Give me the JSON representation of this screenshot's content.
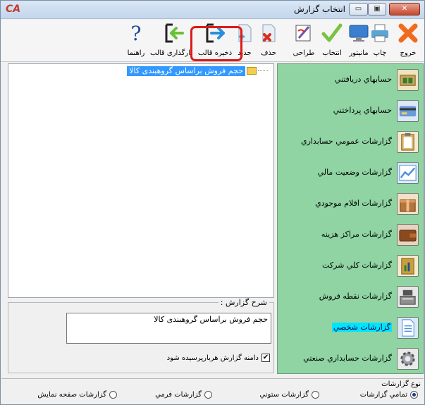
{
  "window": {
    "title": "انتخاب گزارش",
    "logo": "CA",
    "min_glyph": "▭",
    "max_glyph": "▣",
    "close_glyph": "✕"
  },
  "toolbar": {
    "buttons": [
      {
        "label": "خروج",
        "icon": "exit-icon",
        "color": "#f26b1d"
      },
      {
        "label": "چاپ",
        "icon": "printer-icon",
        "color": "#58a6d6"
      },
      {
        "label": "مانیتور",
        "icon": "monitor-icon",
        "color": "#3a7fd0"
      },
      {
        "label": "انتخاب",
        "icon": "checkmark-icon",
        "color": "#7cc242"
      },
      {
        "label": "طراحی",
        "icon": "design-icon",
        "color": "#7a4db3"
      },
      {
        "label": "حذف",
        "icon": "delete-icon",
        "color": "#d92d20"
      },
      {
        "label": "جدید",
        "icon": "new-file-icon",
        "color": "#4aa3df"
      },
      {
        "label": "ذخیره قالب",
        "icon": "save-template-icon",
        "color": "#2a8fd8"
      },
      {
        "label": "بارگذاری قالب",
        "icon": "load-template-icon",
        "color": "#6bbf3a"
      },
      {
        "label": "راهنما",
        "icon": "help-icon",
        "color": "#1f4e9a"
      }
    ],
    "help_glyph": "?"
  },
  "tree": {
    "item_label": "حجم فروش براساس گروهبندی کالا"
  },
  "description": {
    "title": "شرح گزارش :",
    "text": "حجم فروش براساس گروهبندی کالا",
    "checkbox_label": "دامنه گزارش هربارپرسیده شود",
    "checkbox_checked": true,
    "check_glyph": "✔"
  },
  "side_menu": {
    "selected_index": 8,
    "items": [
      {
        "label": "حسابهاي دريافتني",
        "icon": "receivables-icon",
        "color": "#c9a35a"
      },
      {
        "label": "حسابهاي پرداختني",
        "icon": "payables-icon",
        "color": "#6a9ad8"
      },
      {
        "label": "گزارشات عمومي حسابداري",
        "icon": "clipboard-icon",
        "color": "#d9b36b"
      },
      {
        "label": "گزارشات وضعيت مالي",
        "icon": "chart-icon",
        "color": "#4d8fd9"
      },
      {
        "label": "گزارشات اقلام موجودي",
        "icon": "box-icon",
        "color": "#b8743a"
      },
      {
        "label": "گزارشات مراكز هزينه",
        "icon": "wallet-icon",
        "color": "#8a4a1f"
      },
      {
        "label": "گزارشات كلي شركت",
        "icon": "company-report-icon",
        "color": "#c9a03a"
      },
      {
        "label": "گزارشات نقطه فروش",
        "icon": "cash-register-icon",
        "color": "#8f8f8f"
      },
      {
        "label": "گزارشات شخصي",
        "icon": "document-icon",
        "color": "#4d8fd9"
      },
      {
        "label": "گزارشات حسابداري صنعتي",
        "icon": "gear-icon",
        "color": "#9aa0a6"
      }
    ]
  },
  "report_type": {
    "title": "نوع گزارشات",
    "options": [
      {
        "label": "تمامي گزارشات",
        "selected": true
      },
      {
        "label": "گزارشات ستوني",
        "selected": false
      },
      {
        "label": "گزارشات فرمي",
        "selected": false
      },
      {
        "label": "گزارشات صفحه نمايش",
        "selected": false
      }
    ]
  }
}
